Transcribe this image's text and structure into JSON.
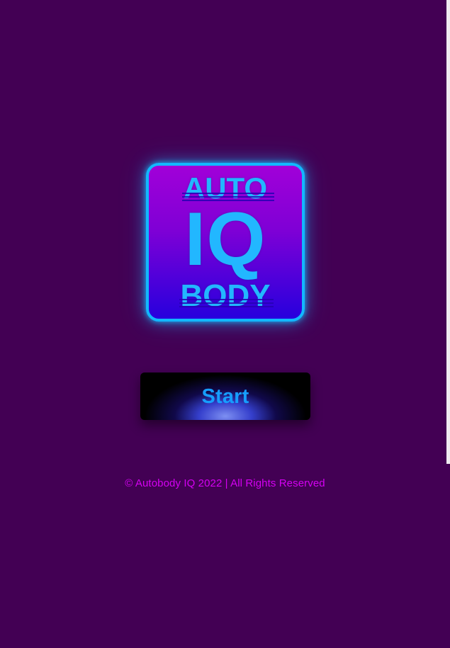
{
  "app": {
    "logo_text": {
      "top": "AUTO",
      "middle": "IQ",
      "bottom": "BODY"
    },
    "start_button_label": "Start",
    "footer_text": "© Autobody IQ 2022 | All Rights Reserved"
  },
  "colors": {
    "background": "#430054",
    "logo_border": "#12b8ff",
    "logo_text": "#22b7ff",
    "button_text": "#169eff",
    "footer_text": "#d400f2"
  }
}
